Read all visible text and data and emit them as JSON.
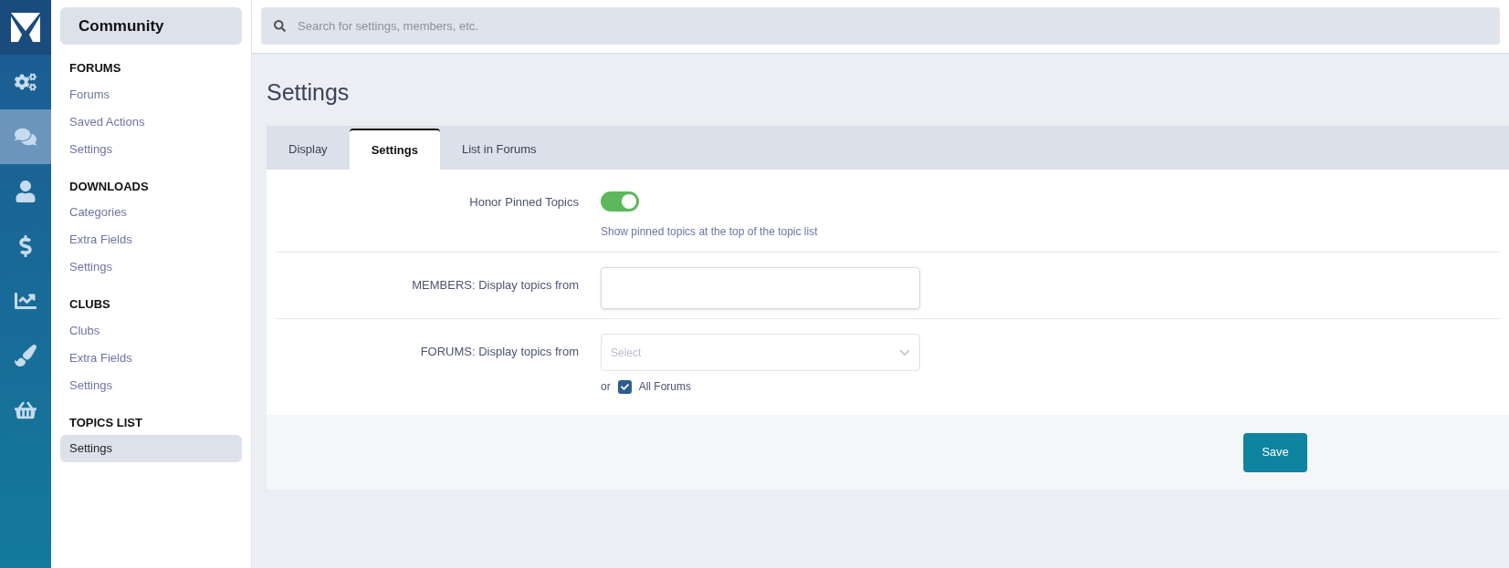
{
  "rail": {
    "items": [
      {
        "kind": "gears",
        "selected": false
      },
      {
        "kind": "comments",
        "selected": true
      },
      {
        "kind": "user",
        "selected": false
      },
      {
        "kind": "dollar",
        "selected": false
      },
      {
        "kind": "chart",
        "selected": false
      },
      {
        "kind": "brush",
        "selected": false
      },
      {
        "kind": "basket",
        "selected": false
      }
    ]
  },
  "sidebar": {
    "title": "Community",
    "sections": [
      {
        "heading": "FORUMS",
        "items": [
          {
            "label": "Forums",
            "selected": false
          },
          {
            "label": "Saved Actions",
            "selected": false
          },
          {
            "label": "Settings",
            "selected": false
          }
        ]
      },
      {
        "heading": "DOWNLOADS",
        "items": [
          {
            "label": "Categories",
            "selected": false
          },
          {
            "label": "Extra Fields",
            "selected": false
          },
          {
            "label": "Settings",
            "selected": false
          }
        ]
      },
      {
        "heading": "CLUBS",
        "items": [
          {
            "label": "Clubs",
            "selected": false
          },
          {
            "label": "Extra Fields",
            "selected": false
          },
          {
            "label": "Settings",
            "selected": false
          }
        ]
      },
      {
        "heading": "TOPICS LIST",
        "items": [
          {
            "label": "Settings",
            "selected": true
          }
        ]
      }
    ]
  },
  "search": {
    "placeholder": "Search for settings, members, etc."
  },
  "page_title": "Settings",
  "tabs": [
    {
      "label": "Display",
      "selected": false
    },
    {
      "label": "Settings",
      "selected": true
    },
    {
      "label": "List in Forums",
      "selected": false
    }
  ],
  "rows": [
    {
      "kind": "toggle",
      "label": "Honor Pinned Topics",
      "on": true,
      "description": "Show pinned topics at the top of the topic list"
    },
    {
      "kind": "text",
      "label": "MEMBERS: Display topics from"
    },
    {
      "kind": "select",
      "label": "FORUMS: Display topics from",
      "placeholder": "Select",
      "or_text": "or",
      "checkbox_label": "All Forums",
      "checked": true
    }
  ],
  "save_button": "Save"
}
